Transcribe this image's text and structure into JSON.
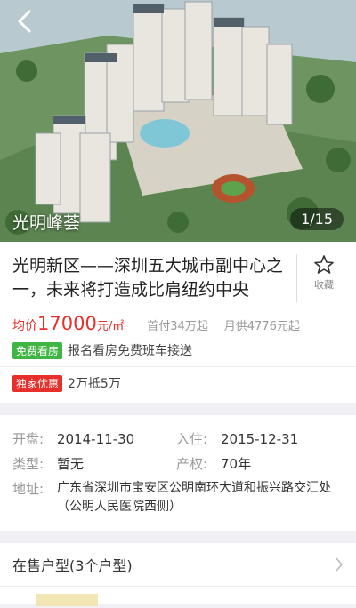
{
  "hero": {
    "caption": "光明峰荟",
    "counter": "1/15",
    "back_icon": "back-arrow-icon"
  },
  "listing": {
    "title": "光明新区——深圳五大城市副中心之一，未来将打造成比肩纽约中央",
    "favorite_label": "收藏",
    "price_prefix": "均价",
    "price_value": "17000",
    "price_unit": "元/㎡",
    "down_payment": "首付34万起",
    "monthly_payment": "月供4776元起",
    "tags": [
      {
        "badge": "免费看房",
        "text": "报名看房免费班车接送",
        "color": "#3fb544"
      },
      {
        "badge": "独家优惠",
        "text": "2万抵5万",
        "color": "#e7302c"
      }
    ]
  },
  "details": {
    "open_label": "开盘:",
    "open_value": "2014-11-30",
    "move_label": "入住:",
    "move_value": "2015-12-31",
    "type_label": "类型:",
    "type_value": "暂无",
    "rights_label": "产权:",
    "rights_value": "70年",
    "address_label": "地址:",
    "address_value": "广东省深圳市宝安区公明南环大道和振兴路交汇处（公明人民医院西侧）"
  },
  "units_section": {
    "label": "在售户型(3个户型)"
  }
}
